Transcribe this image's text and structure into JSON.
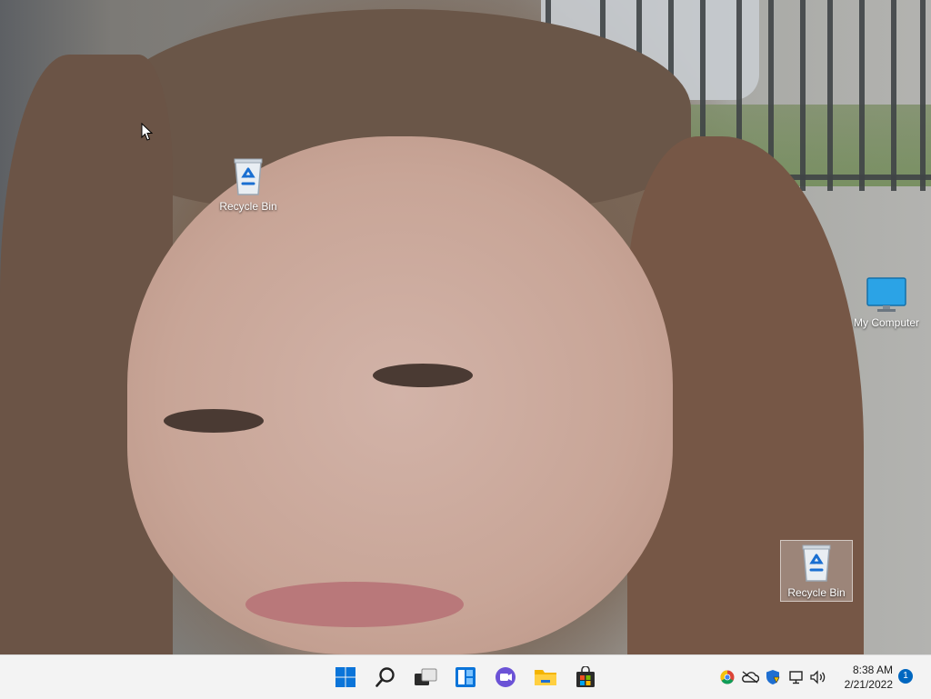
{
  "desktop": {
    "icons": [
      {
        "label": "Recycle Bin"
      },
      {
        "label": "My Computer"
      },
      {
        "label": "Recycle Bin"
      }
    ]
  },
  "taskbar": {
    "buttons": [
      {
        "icon": "windows-start-icon"
      },
      {
        "icon": "search-icon"
      },
      {
        "icon": "task-view-icon"
      },
      {
        "icon": "widgets-icon"
      },
      {
        "icon": "chat-icon"
      },
      {
        "icon": "file-explorer-icon"
      },
      {
        "icon": "store-icon"
      }
    ],
    "tray": {
      "icons": [
        "chrome-icon",
        "onedrive-icon",
        "security-icon",
        "network-icon",
        "volume-icon"
      ],
      "time": "8:38 AM",
      "date": "2/21/2022",
      "notification_count": "1"
    }
  },
  "colors": {
    "taskbar_bg": "#f3f3f3",
    "accent": "#0067c0"
  }
}
